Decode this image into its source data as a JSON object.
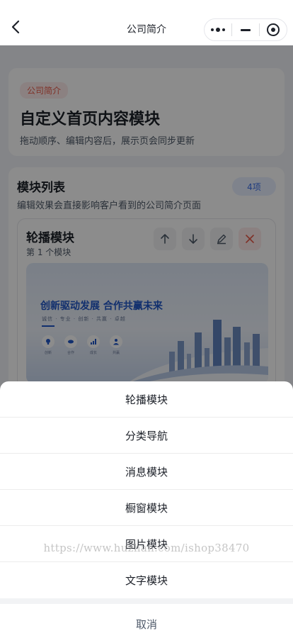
{
  "nav": {
    "title": "公司简介"
  },
  "hero": {
    "tag": "公司简介",
    "title": "自定义首页内容模块",
    "subtitle": "拖动顺序、编辑内容后，展示页会同步更新"
  },
  "module_list": {
    "title": "模块列表",
    "count_badge": "4项",
    "subtitle": "编辑效果会直接影响客户看到的公司简介页面",
    "modules": [
      {
        "title": "轮播模块",
        "subtitle": "第 1 个模块",
        "banner": {
          "headline": "创新驱动发展  合作共赢未来",
          "tags": "诚信 · 专业 · 创新 · 共赢 · 卓越",
          "icons": [
            {
              "icon": "bulb-icon",
              "label": "创新"
            },
            {
              "icon": "handshake-icon",
              "label": "合作"
            },
            {
              "icon": "chart-icon",
              "label": "成长"
            },
            {
              "icon": "people-icon",
              "label": "共赢"
            }
          ]
        }
      }
    ]
  },
  "action_sheet": {
    "items": [
      "轮播模块",
      "分类导航",
      "消息模块",
      "橱窗模块",
      "图片模块",
      "文字模块"
    ],
    "cancel": "取消"
  },
  "watermark": "https://www.huzhan.com/ishop38470",
  "colors": {
    "accent": "#3a6ee8",
    "tag_red": "#e85a48",
    "banner_blue": "#1f56c8"
  }
}
